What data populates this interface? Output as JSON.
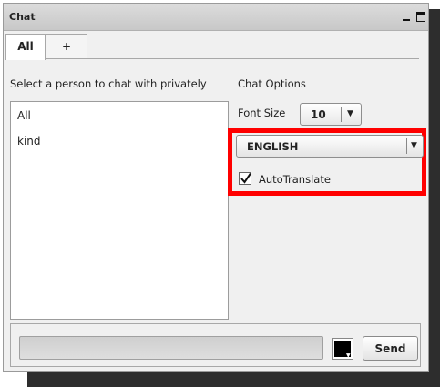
{
  "window": {
    "title": "Chat"
  },
  "tabs": [
    {
      "label": "All"
    },
    {
      "label": "+"
    }
  ],
  "left": {
    "label": "Select a person to chat with privately",
    "persons": [
      "All",
      "kind"
    ]
  },
  "options": {
    "label": "Chat Options",
    "font_size_label": "Font Size",
    "font_size_value": "10",
    "language_value": "ENGLISH",
    "autotranslate_label": "AutoTranslate",
    "autotranslate_checked": true
  },
  "composer": {
    "message_value": "",
    "color_value": "#000000",
    "send_label": "Send"
  },
  "colors": {
    "highlight": "#ff0000"
  }
}
